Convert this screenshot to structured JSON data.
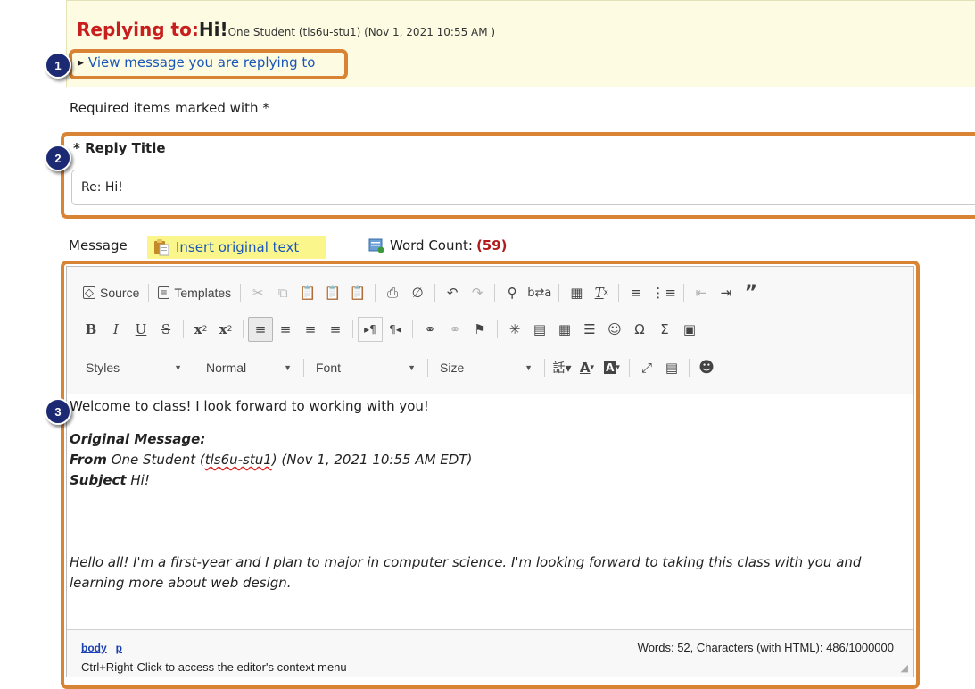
{
  "reply_header": {
    "prefix": "Replying to:",
    "subject": "Hi!",
    "meta": "One Student (tls6u-stu1) (Nov 1, 2021 10:55 AM )",
    "view_link": "View message you are replying to"
  },
  "required_note": "Required items marked with *",
  "reply_title": {
    "label": "* Reply Title",
    "value": "Re: Hi!"
  },
  "message_row": {
    "label": "Message",
    "insert_original": "Insert original text",
    "word_count_label": "Word Count:",
    "word_count_value": "(59)"
  },
  "toolbar": {
    "source": "Source",
    "templates": "Templates",
    "styles": "Styles",
    "format": "Normal",
    "font": "Font",
    "size": "Size"
  },
  "editor_content": {
    "line1": "Welcome to class! I look forward to working with you!",
    "orig_heading": "Original Message:",
    "from_label": "From",
    "from_value_pre": "One Student (",
    "from_user": "tls6u-stu1",
    "from_value_post": ") (Nov 1, 2021 10:55 AM EDT)",
    "subject_label": "Subject",
    "subject_value": "Hi!",
    "body": "Hello all! I'm a first-year and I plan to major in computer science. I'm looking forward to taking this class with you and learning more about web design."
  },
  "status": {
    "path_body": "body",
    "path_p": "p",
    "counter": "Words: 52, Characters (with HTML): 486/1000000",
    "hint": "Ctrl+Right-Click to access the editor's context menu"
  },
  "callouts": [
    "1",
    "2",
    "3"
  ],
  "colors": {
    "callout_fill": "#1c2a73",
    "highlight_border": "#d98334",
    "reply_prefix": "#c81e1e",
    "link": "#1a56b8",
    "insert_highlight": "#fbf68c",
    "header_bg": "#fdfce3"
  }
}
